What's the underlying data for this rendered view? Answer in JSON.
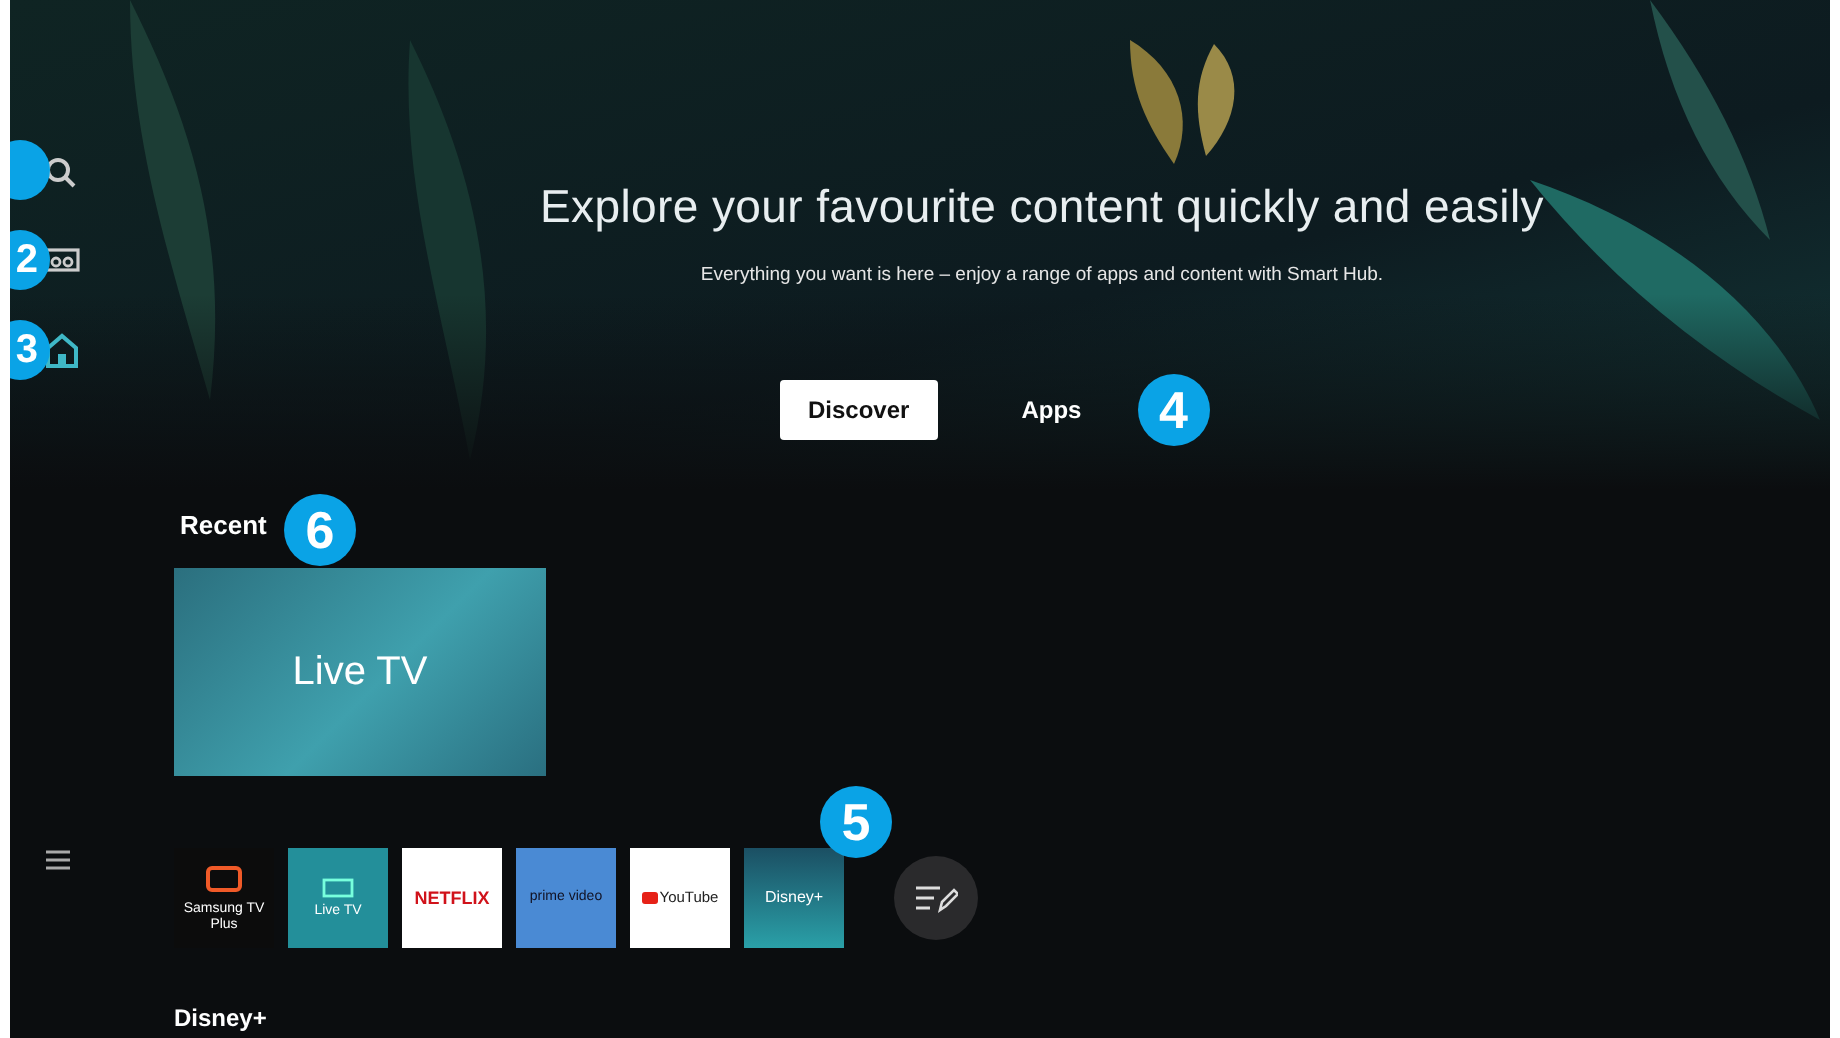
{
  "sidebar": {
    "items": [
      {
        "kind": "search",
        "selected": false
      },
      {
        "kind": "ambient",
        "selected": false,
        "badge": "2"
      },
      {
        "kind": "home",
        "selected": true,
        "badge": "3"
      }
    ],
    "menu": {
      "kind": "menu"
    }
  },
  "hero": {
    "title": "Explore your favourite content quickly and easily",
    "subtitle": "Everything you want is here – enjoy a range of apps and content with Smart Hub."
  },
  "tabs": [
    {
      "label": "Discover",
      "selected": true
    },
    {
      "label": "Apps",
      "selected": false
    }
  ],
  "tabs_badge": "4",
  "recent": {
    "heading": "Recent",
    "badge": "6",
    "tile": "Live TV"
  },
  "apps_badge": "5",
  "apps": [
    {
      "kind": "tvplus",
      "label": "Samsung TV Plus"
    },
    {
      "kind": "livetv",
      "label": "Live TV"
    },
    {
      "kind": "netflix",
      "label": "NETFLIX"
    },
    {
      "kind": "prime",
      "label": "prime video"
    },
    {
      "kind": "youtube",
      "label": "YouTube"
    },
    {
      "kind": "disney",
      "label": "Disney+"
    },
    {
      "kind": "edit"
    }
  ],
  "section": "Disney+"
}
